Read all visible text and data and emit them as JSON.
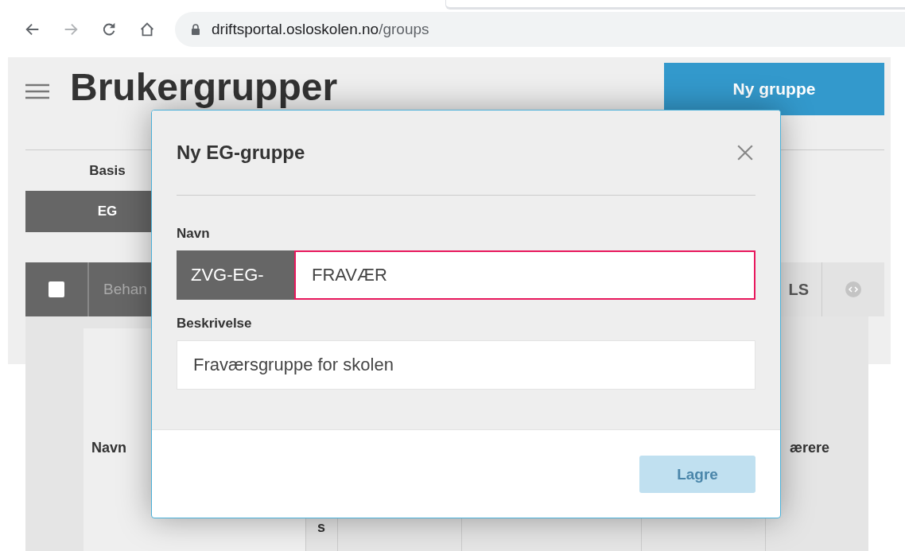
{
  "browser": {
    "nav_buttons": [
      {
        "kind": "back",
        "disabled": false
      },
      {
        "kind": "forward",
        "disabled": true
      },
      {
        "kind": "reload",
        "disabled": false
      },
      {
        "kind": "home",
        "disabled": false
      }
    ],
    "url_host": "driftsportal.osloskolen.no",
    "url_path": "/groups"
  },
  "page": {
    "title": "Brukergrupper",
    "new_button": "Ny gruppe",
    "section_label": "Basis",
    "tabs": [
      {
        "label": "EG",
        "selected": true
      }
    ],
    "table": {
      "select_all_checked": false,
      "header_left": "Behan",
      "header_right": "LS",
      "body_cells": [
        "Navn",
        "s",
        "ærere"
      ]
    }
  },
  "modal": {
    "title": "Ny EG-gruppe",
    "fields": [
      {
        "label": "Navn",
        "prefix": "ZVG-EG-",
        "value": "FRAVÆR",
        "invalid": true
      },
      {
        "label": "Beskrivelse",
        "value": "Fraværsgruppe for skolen",
        "invalid": false
      }
    ],
    "save_button": {
      "label": "Lagre",
      "disabled": true
    }
  }
}
